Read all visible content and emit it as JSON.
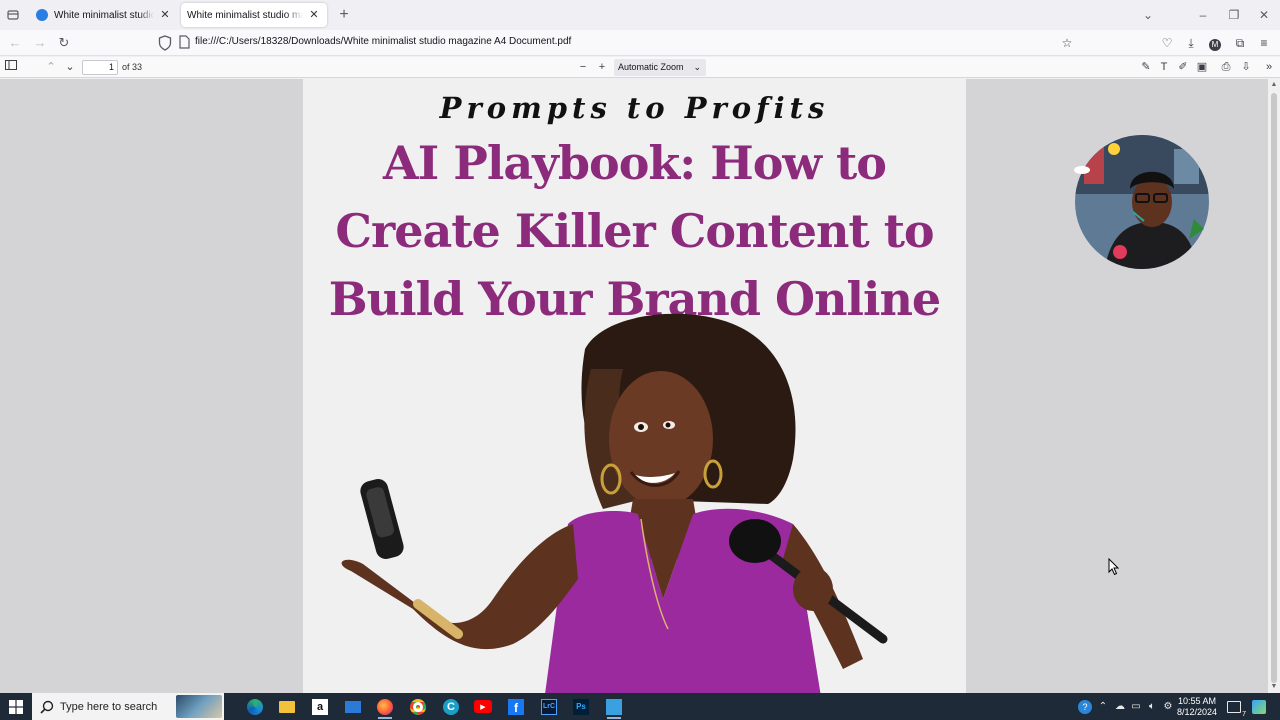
{
  "browser": {
    "tabs": [
      {
        "title": "White minimalist studio magazi",
        "active": false
      },
      {
        "title": "White minimalist studio magazine",
        "active": true
      }
    ],
    "new_tab_label": "+",
    "url": "file:///C:/Users/18328/Downloads/White minimalist studio magazine A4 Document.pdf",
    "account_initial": "M"
  },
  "pdf_toolbar": {
    "page_number": "1",
    "page_count": "of 33",
    "zoom": "Automatic Zoom"
  },
  "document": {
    "kicker": "Prompts to Profits",
    "headline": [
      "AI Playbook: How to",
      "Create Killer Content to",
      "Build Your Brand Online"
    ]
  },
  "taskbar": {
    "search_placeholder": "Type here to search",
    "apps": [
      "edge",
      "file-explorer",
      "amazon",
      "mail",
      "firefox",
      "chrome",
      "edge-canary",
      "youtube",
      "facebook",
      "lightroom-classic",
      "photoshop",
      "paint"
    ],
    "time": "10:55 AM",
    "date": "8/12/2024",
    "notification_count": "7"
  },
  "colors": {
    "headline": "#8c2b7b",
    "viewer_bg": "#d4d4d7",
    "taskbar": "#1f2a38"
  }
}
